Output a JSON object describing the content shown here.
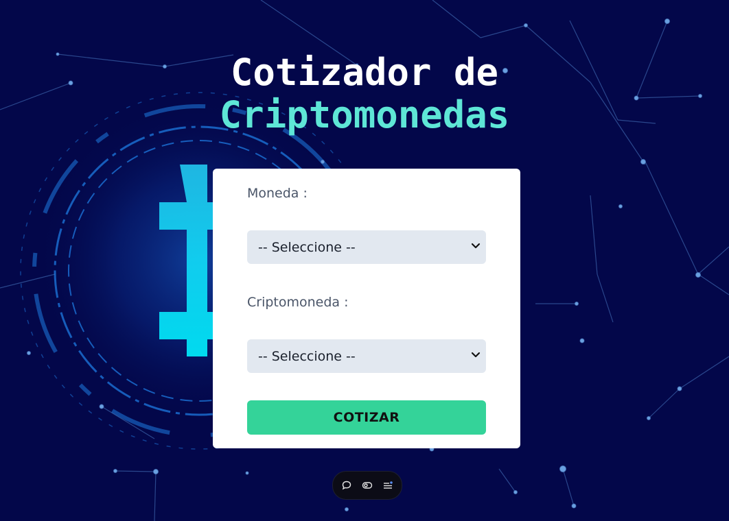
{
  "header": {
    "title_line1": "Cotizador de",
    "title_line2": "Criptomonedas"
  },
  "form": {
    "currency_label": "Moneda :",
    "currency_select_value": "-- Seleccione --",
    "crypto_label": "Criptomoneda :",
    "crypto_select_value": "-- Seleccione --",
    "submit_label": "COTIZAR"
  },
  "toolbar": {
    "icons": [
      "chat-bubble-icon",
      "toggle-view-icon",
      "menu-list-icon"
    ]
  },
  "colors": {
    "background": "#03074a",
    "title_accent": "#5ee6d6",
    "button": "#34d399",
    "select_bg": "#e2e8f0"
  }
}
